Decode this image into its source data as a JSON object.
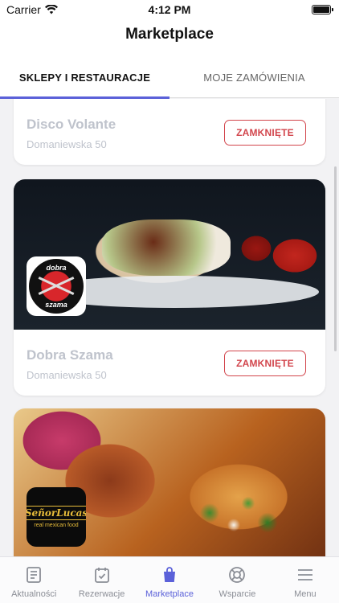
{
  "status_bar": {
    "carrier": "Carrier",
    "time": "4:12 PM"
  },
  "header": {
    "title": "Marketplace"
  },
  "tabs": [
    {
      "label": "SKLEPY I RESTAURACJE",
      "active": true
    },
    {
      "label": "MOJE ZAMÓWIENIA",
      "active": false
    }
  ],
  "stores": [
    {
      "name": "Disco Volante",
      "address": "Domaniewska 50",
      "button": "ZAMKNIĘTE"
    },
    {
      "name": "Dobra Szama",
      "address": "Domaniewska 50",
      "button": "ZAMKNIĘTE",
      "logo_text_top": "dobra",
      "logo_text_bottom": "szama"
    },
    {
      "name": "",
      "address": "",
      "button": "",
      "logo_text_top": "SeñorLucas",
      "logo_text_bottom": "real mexican food"
    }
  ],
  "tab_bar": [
    {
      "label": "Aktualności",
      "icon": "news-icon"
    },
    {
      "label": "Rezerwacje",
      "icon": "calendar-check-icon"
    },
    {
      "label": "Marketplace",
      "icon": "shopping-bag-icon",
      "active": true
    },
    {
      "label": "Wsparcie",
      "icon": "lifebuoy-icon"
    },
    {
      "label": "Menu",
      "icon": "hamburger-menu-icon"
    }
  ],
  "colors": {
    "accent": "#5b61d9",
    "closed": "#d2454c",
    "muted_text": "#bfc3cc"
  }
}
